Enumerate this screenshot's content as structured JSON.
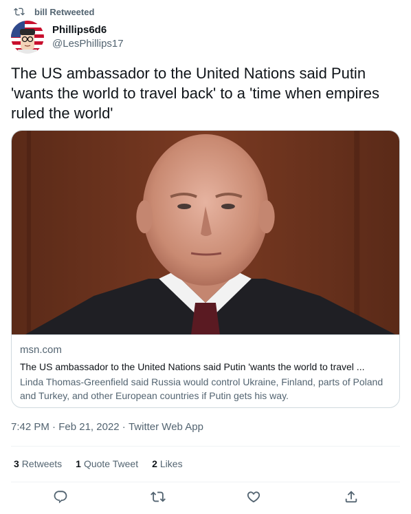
{
  "retweet_context": {
    "label": "bill Retweeted",
    "icon": "retweet-icon"
  },
  "author": {
    "display_name": "Phillips6d6",
    "handle": "@LesPhillips17",
    "avatar_icon": "cartoon-avatar"
  },
  "tweet": {
    "text": "The US ambassador to the United Nations said Putin 'wants the world to travel back' to a 'time when empires ruled the world'"
  },
  "card": {
    "domain": "msn.com",
    "title": "The US ambassador to the United Nations said Putin 'wants the world to travel ...",
    "description": "Linda Thomas-Greenfield said Russia would control Ukraine, Finland, parts of Poland and Turkey, and other European countries if Putin gets his way."
  },
  "meta": {
    "time": "7:42 PM",
    "date": "Feb 21, 2022",
    "source": "Twitter Web App",
    "separator": " · "
  },
  "stats": {
    "retweets_count": "3",
    "retweets_label": "Retweets",
    "quotes_count": "1",
    "quotes_label": "Quote Tweet",
    "likes_count": "2",
    "likes_label": "Likes"
  },
  "actions": [
    "reply-icon",
    "retweet-icon",
    "like-icon",
    "share-icon"
  ],
  "colors": {
    "text": "#0f1419",
    "secondary": "#536471",
    "border": "#cfd9de"
  }
}
